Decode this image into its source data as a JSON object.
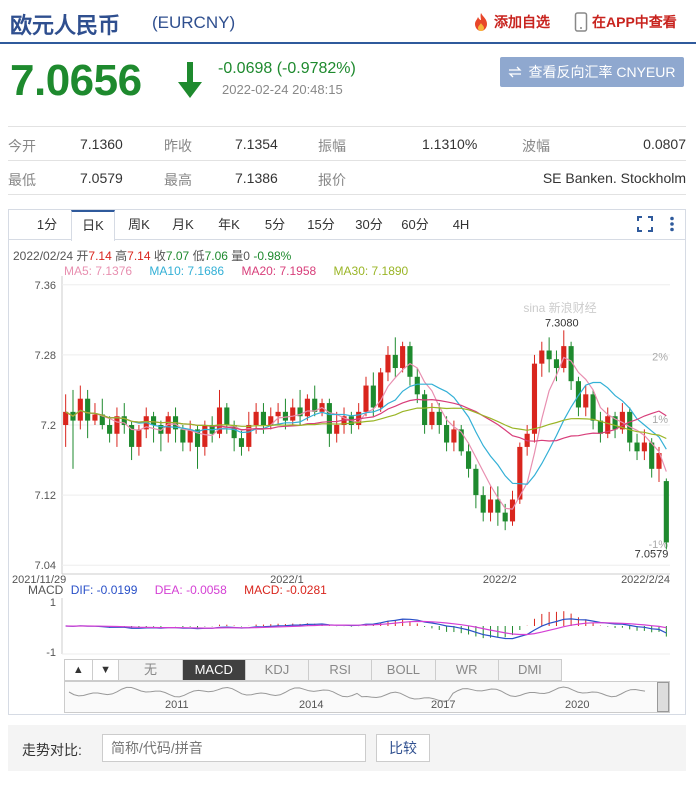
{
  "header": {
    "name": "欧元人民币",
    "code": "(EURCNY)",
    "add_watch": "添加自选",
    "view_in_app": "在APP中查看"
  },
  "quote": {
    "price": "7.0656",
    "change": "-0.0698 (-0.9782%)",
    "timestamp": "2022-02-24 20:48:15",
    "reverse_button": "查看反向汇率 CNYEUR"
  },
  "stats": {
    "row1": [
      {
        "label": "今开",
        "value": "7.1360"
      },
      {
        "label": "昨收",
        "value": "7.1354"
      },
      {
        "label": "振幅",
        "value": "1.1310%"
      },
      {
        "label": "波幅",
        "value": "0.0807"
      }
    ],
    "row2": [
      {
        "label": "最低",
        "value": "7.0579"
      },
      {
        "label": "最高",
        "value": "7.1386"
      },
      {
        "label": "报价",
        "value": "SE Banken. Stockholm"
      }
    ]
  },
  "periods": [
    "1分",
    "日K",
    "周K",
    "月K",
    "年K",
    "5分",
    "15分",
    "30分",
    "60分",
    "4H"
  ],
  "selected_period": "日K",
  "ohlc_line": {
    "date": "2022/02/24",
    "open_label": "开",
    "open": "7.14",
    "high_label": "高",
    "high": "7.14",
    "close_label": "收",
    "close": "7.07",
    "low_label": "低",
    "low": "7.06",
    "vol_label": "量",
    "vol": "0",
    "pct": "-0.98%"
  },
  "ma_legend": {
    "ma5": "MA5: 7.1376",
    "ma10": "MA10: 7.1686",
    "ma20": "MA20: 7.1958",
    "ma30": "MA30: 7.1890"
  },
  "colors": {
    "up": "#d9251d",
    "down": "#1e8a2e",
    "ma5": "#e88fb0",
    "ma10": "#33b0d6",
    "ma20": "#d83e7a",
    "ma30": "#9ab526",
    "dif": "#2950c8",
    "dea": "#d43fd4"
  },
  "macd_legend": {
    "title": "MACD",
    "dif": "DIF: -0.0199",
    "dea": "DEA: -0.0058",
    "macd": "MACD: -0.0281",
    "top": "1",
    "bottom": "-1"
  },
  "indicator_tabs": [
    "无",
    "MACD",
    "KDJ",
    "RSI",
    "BOLL",
    "WR",
    "DMI"
  ],
  "selected_indicator": "MACD",
  "navigator_years": [
    "2011",
    "2014",
    "2017",
    "2020"
  ],
  "watermark": "sina 新浪财经",
  "compare": {
    "label": "走势对比:",
    "placeholder": "简称/代码/拼音",
    "button": "比较"
  },
  "chart_data": {
    "type": "candlestick",
    "y_left_ticks": [
      "7.36",
      "7.28",
      "7.2",
      "7.12",
      "7.04"
    ],
    "y_right_ticks": [
      "2%",
      "1%",
      "",
      "-1%"
    ],
    "x_labels": [
      "2021/11/29",
      "2022/1",
      "2022/2",
      "2022/2/24"
    ],
    "ylim": [
      7.03,
      7.37
    ],
    "annotations": {
      "max": "7.3080",
      "min": "7.0579"
    },
    "candles": [
      [
        7.2,
        7.215,
        7.235,
        7.175
      ],
      [
        7.215,
        7.205,
        7.24,
        7.15
      ],
      [
        7.205,
        7.23,
        7.245,
        7.195
      ],
      [
        7.23,
        7.205,
        7.24,
        7.185
      ],
      [
        7.205,
        7.212,
        7.225,
        7.2
      ],
      [
        7.212,
        7.2,
        7.23,
        7.195
      ],
      [
        7.2,
        7.19,
        7.21,
        7.18
      ],
      [
        7.19,
        7.21,
        7.22,
        7.175
      ],
      [
        7.21,
        7.2,
        7.225,
        7.19
      ],
      [
        7.2,
        7.175,
        7.205,
        7.16
      ],
      [
        7.175,
        7.195,
        7.2,
        7.165
      ],
      [
        7.195,
        7.21,
        7.22,
        7.185
      ],
      [
        7.21,
        7.2,
        7.215,
        7.18
      ],
      [
        7.2,
        7.19,
        7.205,
        7.17
      ],
      [
        7.19,
        7.21,
        7.215,
        7.18
      ],
      [
        7.21,
        7.195,
        7.22,
        7.18
      ],
      [
        7.195,
        7.18,
        7.2,
        7.17
      ],
      [
        7.18,
        7.195,
        7.205,
        7.17
      ],
      [
        7.195,
        7.175,
        7.2,
        7.15
      ],
      [
        7.175,
        7.2,
        7.205,
        7.165
      ],
      [
        7.2,
        7.19,
        7.21,
        7.18
      ],
      [
        7.19,
        7.22,
        7.24,
        7.185
      ],
      [
        7.22,
        7.2,
        7.225,
        7.19
      ],
      [
        7.2,
        7.185,
        7.205,
        7.17
      ],
      [
        7.185,
        7.175,
        7.195,
        7.165
      ],
      [
        7.175,
        7.2,
        7.215,
        7.17
      ],
      [
        7.2,
        7.215,
        7.225,
        7.19
      ],
      [
        7.215,
        7.2,
        7.225,
        7.19
      ],
      [
        7.2,
        7.21,
        7.22,
        7.195
      ],
      [
        7.21,
        7.215,
        7.225,
        7.2
      ],
      [
        7.215,
        7.205,
        7.23,
        7.195
      ],
      [
        7.205,
        7.22,
        7.23,
        7.2
      ],
      [
        7.22,
        7.21,
        7.24,
        7.2
      ],
      [
        7.21,
        7.23,
        7.235,
        7.205
      ],
      [
        7.23,
        7.215,
        7.245,
        7.21
      ],
      [
        7.215,
        7.225,
        7.23,
        7.21
      ],
      [
        7.225,
        7.19,
        7.23,
        7.175
      ],
      [
        7.19,
        7.2,
        7.215,
        7.18
      ],
      [
        7.2,
        7.21,
        7.22,
        7.19
      ],
      [
        7.21,
        7.2,
        7.215,
        7.19
      ],
      [
        7.2,
        7.215,
        7.225,
        7.195
      ],
      [
        7.215,
        7.245,
        7.255,
        7.21
      ],
      [
        7.245,
        7.22,
        7.26,
        7.21
      ],
      [
        7.22,
        7.26,
        7.265,
        7.215
      ],
      [
        7.26,
        7.28,
        7.29,
        7.25
      ],
      [
        7.28,
        7.265,
        7.3,
        7.255
      ],
      [
        7.265,
        7.29,
        7.295,
        7.26
      ],
      [
        7.29,
        7.255,
        7.295,
        7.245
      ],
      [
        7.255,
        7.235,
        7.265,
        7.225
      ],
      [
        7.235,
        7.2,
        7.24,
        7.19
      ],
      [
        7.2,
        7.215,
        7.225,
        7.195
      ],
      [
        7.215,
        7.2,
        7.225,
        7.19
      ],
      [
        7.2,
        7.18,
        7.21,
        7.17
      ],
      [
        7.18,
        7.195,
        7.205,
        7.17
      ],
      [
        7.195,
        7.17,
        7.2,
        7.165
      ],
      [
        7.17,
        7.15,
        7.18,
        7.14
      ],
      [
        7.15,
        7.12,
        7.155,
        7.105
      ],
      [
        7.12,
        7.1,
        7.13,
        7.09
      ],
      [
        7.1,
        7.115,
        7.13,
        7.09
      ],
      [
        7.115,
        7.1,
        7.13,
        7.085
      ],
      [
        7.1,
        7.09,
        7.11,
        7.08
      ],
      [
        7.09,
        7.115,
        7.125,
        7.085
      ],
      [
        7.115,
        7.175,
        7.18,
        7.11
      ],
      [
        7.175,
        7.19,
        7.2,
        7.165
      ],
      [
        7.19,
        7.27,
        7.28,
        7.18
      ],
      [
        7.27,
        7.285,
        7.295,
        7.255
      ],
      [
        7.285,
        7.275,
        7.3,
        7.26
      ],
      [
        7.275,
        7.265,
        7.285,
        7.25
      ],
      [
        7.265,
        7.29,
        7.308,
        7.26
      ],
      [
        7.29,
        7.25,
        7.295,
        7.24
      ],
      [
        7.25,
        7.22,
        7.255,
        7.21
      ],
      [
        7.22,
        7.235,
        7.245,
        7.21
      ],
      [
        7.235,
        7.205,
        7.24,
        7.195
      ],
      [
        7.205,
        7.19,
        7.215,
        7.18
      ],
      [
        7.19,
        7.21,
        7.22,
        7.185
      ],
      [
        7.21,
        7.195,
        7.215,
        7.185
      ],
      [
        7.195,
        7.215,
        7.225,
        7.19
      ],
      [
        7.215,
        7.18,
        7.22,
        7.17
      ],
      [
        7.18,
        7.17,
        7.19,
        7.16
      ],
      [
        7.17,
        7.18,
        7.195,
        7.16
      ],
      [
        7.18,
        7.15,
        7.185,
        7.14
      ],
      [
        7.15,
        7.168,
        7.175,
        7.135
      ],
      [
        7.136,
        7.066,
        7.139,
        7.058
      ]
    ]
  }
}
